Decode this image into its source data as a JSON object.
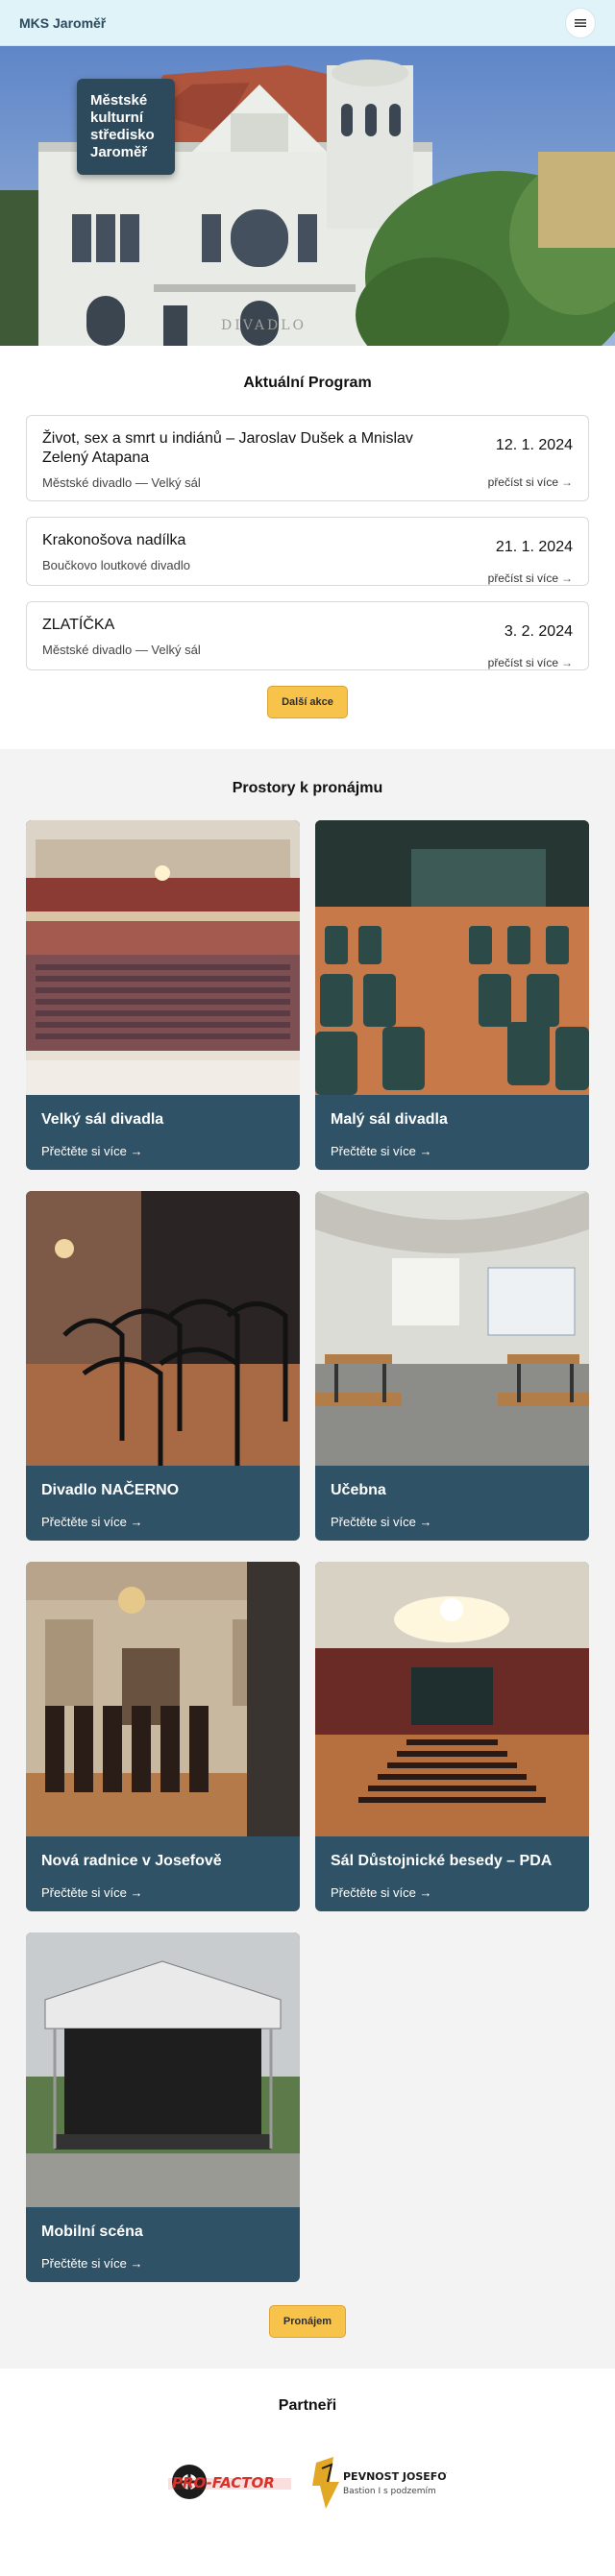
{
  "header": {
    "brand": "MKS Jaroměř",
    "menu_icon": "hamburger-icon"
  },
  "hero": {
    "title": "Městské kulturní středisko Jaroměř",
    "sign_text": "DIVADLO"
  },
  "program": {
    "title": "Aktuální Program",
    "events": [
      {
        "title": "Život, sex a smrt u indiánů – Jaroslav Dušek a Mnislav Zelený Atapana",
        "venue": "Městské divadlo — Velký sál",
        "date": "12. 1. 2024",
        "more": "přečíst si více"
      },
      {
        "title": "Krakonošova nadílka",
        "venue": "Boučkovo loutkové divadlo",
        "date": "21. 1. 2024",
        "more": "přečíst si více"
      },
      {
        "title": "ZLATÍČKA",
        "venue": "Městské divadlo — Velký sál",
        "date": "3. 2. 2024",
        "more": "přečíst si více"
      }
    ],
    "more_button": "Další akce"
  },
  "spaces": {
    "title": "Prostory k pronájmu",
    "cards": [
      {
        "title": "Velký sál divadla",
        "more": "Přečtěte si více"
      },
      {
        "title": "Malý sál divadla",
        "more": "Přečtěte si více"
      },
      {
        "title": "Divadlo NAČERNO",
        "more": "Přečtěte si více"
      },
      {
        "title": "Učebna",
        "more": "Přečtěte si více"
      },
      {
        "title": "Nová radnice v Josefově",
        "more": "Přečtěte si více"
      },
      {
        "title": "Sál Důstojnické besedy – PDA",
        "more": "Přečtěte si více"
      },
      {
        "title": "Mobilní scéna",
        "more": "Přečtěte si více"
      }
    ],
    "rent_button": "Pronájem"
  },
  "partners": {
    "title": "Partneři",
    "logos": [
      {
        "name": "PRO-FACTOR"
      },
      {
        "name": "PEVNOST JOSEFOV",
        "tagline": "Bastion I s podzemím"
      }
    ]
  },
  "colors": {
    "accent_yellow": "#f8c34b",
    "card_blue": "#2f5266",
    "header_bg": "#dff3f8"
  }
}
